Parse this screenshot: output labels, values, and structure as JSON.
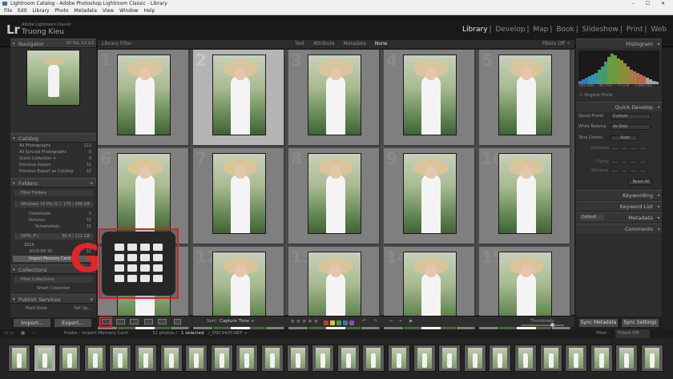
{
  "window": {
    "title": "Lightroom Catalog - Adobe Photoshop Lightroom Classic - Library",
    "controls": "– ☐ ✕"
  },
  "menu": [
    "File",
    "Edit",
    "Library",
    "Photo",
    "Metadata",
    "View",
    "Window",
    "Help"
  ],
  "identity": {
    "logo": "Lr",
    "product": "Adobe Lightroom Classic",
    "user": "Truong Kieu"
  },
  "modules": [
    "Library",
    "Develop",
    "Map",
    "Book",
    "Slideshow",
    "Print",
    "Web"
  ],
  "active_module": "Library",
  "left": {
    "navigator": "Navigator",
    "navigator_zoom": "FIT  FILL  1:1  3:1",
    "catalog": "Catalog",
    "catalog_items": [
      {
        "label": "All Photographs",
        "count": "111"
      },
      {
        "label": "All Synced Photographs",
        "count": "0"
      },
      {
        "label": "Quick Collection +",
        "count": "0"
      },
      {
        "label": "Previous Import",
        "count": "32"
      },
      {
        "label": "Previous Export as Catalog",
        "count": "32"
      }
    ],
    "folders": "Folders",
    "filter_folders": "Filter Folders",
    "folder_items": [
      {
        "label": "Windows 10 Pro (C:)",
        "count": "176 / 298 GB"
      },
      {
        "label": "Downloads",
        "count": "0"
      },
      {
        "label": "Pictures",
        "count": "32"
      },
      {
        "label": "Screenshots",
        "count": "32"
      },
      {
        "label": "DATA (F:)",
        "count": "85.4 / 112 GB"
      },
      {
        "label": "2019",
        "count": "32"
      },
      {
        "label": "2019-08-30",
        "count": "32"
      },
      {
        "label": "Import Memory Card",
        "count": "32"
      }
    ],
    "collections": "Collections",
    "filter_collections": "Filter Collections",
    "collection_items": [
      {
        "label": "Smart Collection",
        "count": ""
      }
    ],
    "publish": "Publish Services",
    "publish_item": "Hard Drive",
    "publish_setup": "Set Up..."
  },
  "filterbar": {
    "label": "Library Filter :",
    "tabs": [
      "Text",
      "Attribute",
      "Metadata",
      "None"
    ],
    "selected": "None",
    "filters_off": "Filters Off ÷"
  },
  "grid": {
    "numbers": [
      "1",
      "2",
      "3",
      "4",
      "5",
      "6",
      "7",
      "8",
      "9",
      "10",
      "11",
      "12",
      "13",
      "14",
      "15"
    ],
    "selected_index": 1
  },
  "right": {
    "histogram": "Histogram",
    "hist_info": [
      "ISO 200",
      "85 mm",
      "f / 1.8",
      "1/400 sec"
    ],
    "original_photo": "Original Photo",
    "quick_develop": "Quick Develop",
    "saved_preset_label": "Saved Preset",
    "saved_preset_value": "Custom",
    "white_balance_label": "White Balance",
    "white_balance_value": "As Shot",
    "tone_control_label": "Tone Control",
    "auto_label": "Auto",
    "exposure_label": "Exposure",
    "clarity_label": "Clarity",
    "vibrance_label": "Vibrance",
    "reset_all": "Reset All",
    "keywording": "Keywording",
    "keyword_list": "Keyword List",
    "metadata": "Metadata",
    "metadata_preset": "Default",
    "comments": "Comments"
  },
  "toolbar": {
    "sort_label": "Sort:",
    "sort_value": "Capture Time ÷",
    "stars": "★★★★★",
    "thumbnails": "Thumbnails"
  },
  "buttons": {
    "import": "Import...",
    "export": "Export...",
    "sync_metadata": "Sync Metadata",
    "sync_settings": "Sync Settings"
  },
  "status": {
    "source": "Folder : Import Memory Card",
    "count": "32 photos /",
    "selected": "1 selected",
    "file": "/_DSC3400.NEF ÷",
    "filter_label": "Filter :",
    "filter_value": "Filters Off"
  },
  "overlay": {
    "shortcut_key": "G"
  },
  "colors": {
    "annotation_red": "#e01d23",
    "label_red": "#c0392b",
    "label_yellow": "#d4c23a",
    "label_green": "#4c9a3a",
    "label_blue": "#3a6fc4",
    "label_purple": "#8a4bb0",
    "active_module": "#eeeeee"
  }
}
